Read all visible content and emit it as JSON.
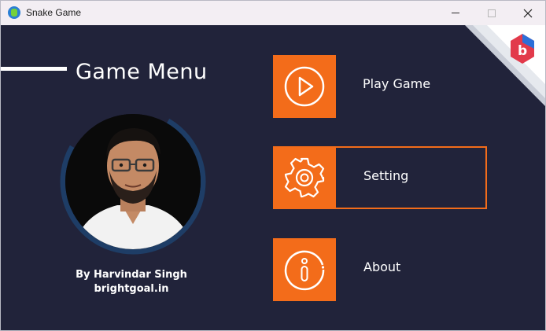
{
  "window": {
    "title": "Snake Game",
    "app_icon": "snake-game-icon",
    "controls": [
      "minimize-icon",
      "maximize-icon",
      "close-icon"
    ]
  },
  "menu": {
    "heading": "Game Menu",
    "items": [
      {
        "label": "Play Game",
        "icon": "play-icon"
      },
      {
        "label": "Setting",
        "icon": "gear-icon"
      },
      {
        "label": "About",
        "icon": "info-icon"
      }
    ]
  },
  "profile": {
    "author": "By Harvindar Singh",
    "website": "brightgoal.in"
  },
  "colors": {
    "background": "#21233a",
    "accent": "#f36c1a",
    "ring": "#1e3d66",
    "titlebar": "#f3eef3"
  }
}
